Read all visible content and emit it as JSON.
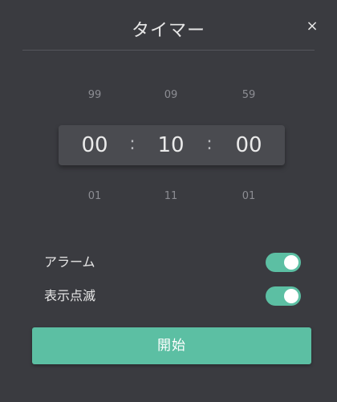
{
  "dialog": {
    "title": "タイマー",
    "close_label": "×"
  },
  "picker": {
    "above": [
      "99",
      "09",
      "59"
    ],
    "selected": {
      "hours": "00",
      "minutes": "10",
      "seconds": "00",
      "separator": ":"
    },
    "below": [
      "01",
      "11",
      "01"
    ]
  },
  "settings": [
    {
      "label": "アラーム",
      "enabled": true
    },
    {
      "label": "表示点滅",
      "enabled": true
    }
  ],
  "start_button": {
    "label": "開始"
  },
  "colors": {
    "accent": "#5cbfa3",
    "background": "#3a3b40"
  },
  "icons": {
    "close": "close-icon"
  }
}
